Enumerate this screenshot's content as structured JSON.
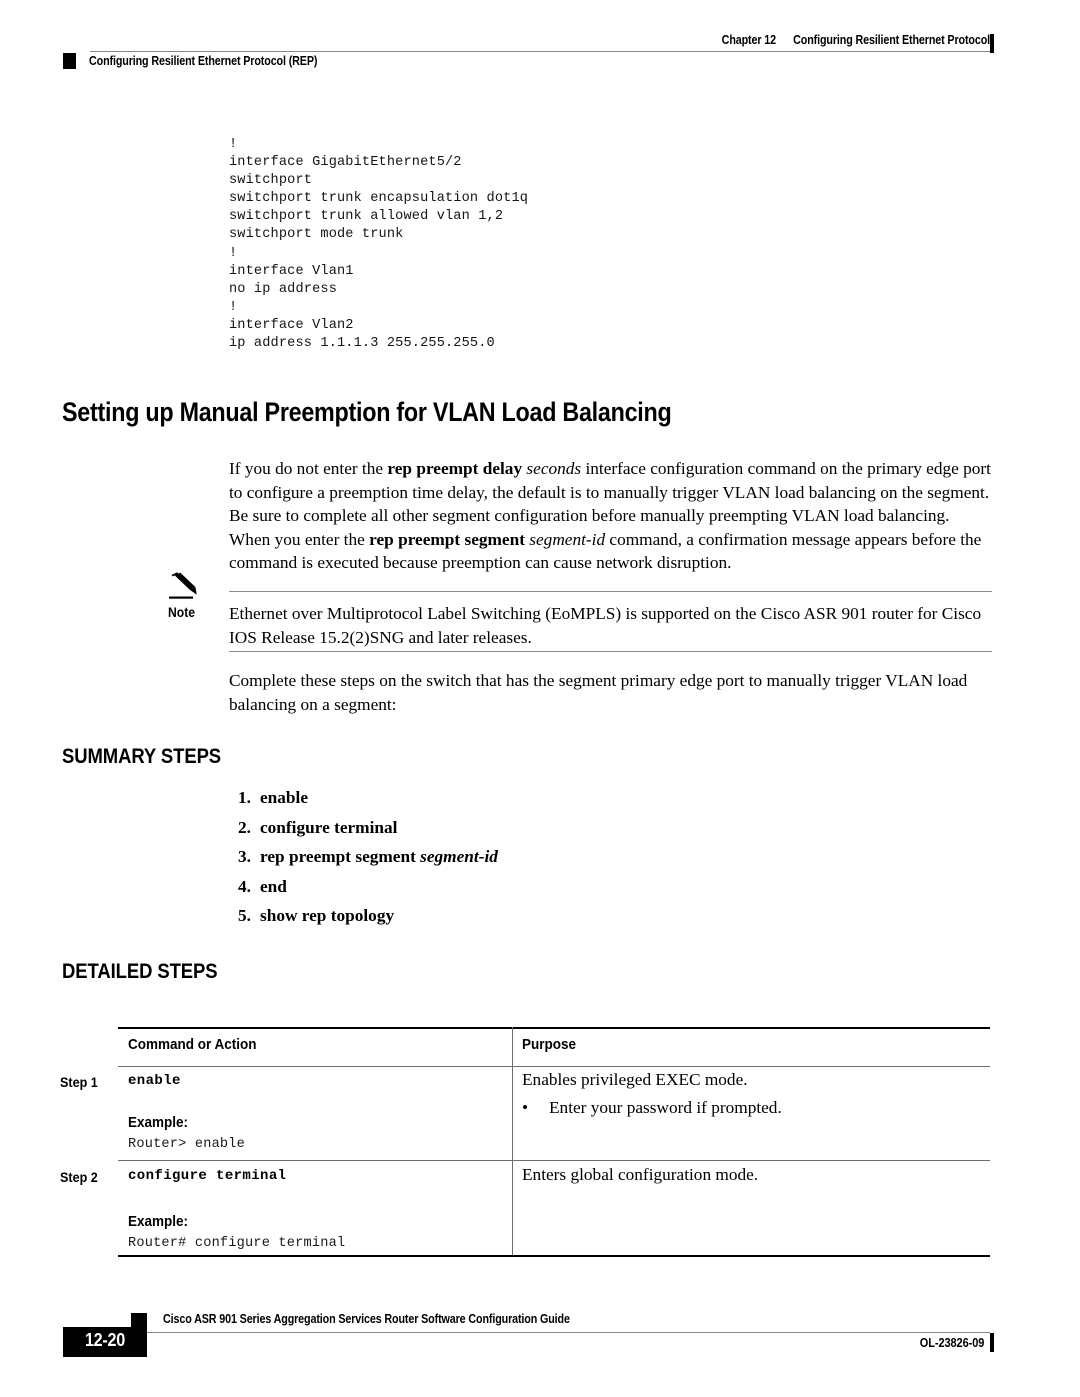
{
  "header": {
    "chapter_number": "Chapter 12",
    "chapter_title": "Configuring Resilient Ethernet Protocol",
    "section_title": "Configuring Resilient Ethernet Protocol (REP)"
  },
  "code_block": {
    "text": "!\ninterface GigabitEthernet5/2\nswitchport\nswitchport trunk encapsulation dot1q\nswitchport trunk allowed vlan 1,2\nswitchport mode trunk\n!\ninterface Vlan1\nno ip address\n!\ninterface Vlan2\nip address 1.1.1.3 255.255.255.0"
  },
  "heading": {
    "title": "Setting up Manual Preemption for VLAN Load Balancing"
  },
  "paragraphs": {
    "intro_1": "If you do not enter the ",
    "intro_cmd1": "rep preempt delay",
    "intro_var1": "seconds",
    "intro_2": " interface configuration command on the primary edge port to configure a preemption time delay, the default is to manually trigger VLAN load balancing on the segment. Be sure to complete all other segment configuration before manually preempting VLAN load balancing. When you enter the ",
    "intro_cmd2": "rep preempt segment",
    "intro_var2": "segment-id",
    "intro_3": " command, a confirmation message appears before the command is executed because preemption can cause network disruption.",
    "complete": "Complete these steps on the switch that has the segment primary edge port to manually trigger VLAN load balancing on a segment:"
  },
  "note": {
    "label": "Note",
    "icon": "pencil-icon",
    "body": "Ethernet over Multiprotocol Label Switching (EoMPLS) is supported on the Cisco ASR 901 router for Cisco IOS Release 15.2(2)SNG and later releases."
  },
  "summary_steps": {
    "heading": "SUMMARY STEPS",
    "items": [
      {
        "num": "1.",
        "text": "enable",
        "var": ""
      },
      {
        "num": "2.",
        "text": "configure terminal",
        "var": ""
      },
      {
        "num": "3.",
        "text": "rep preempt segment ",
        "var": "segment-id"
      },
      {
        "num": "4.",
        "text": "end",
        "var": ""
      },
      {
        "num": "5.",
        "text": "show rep topology",
        "var": ""
      }
    ]
  },
  "detailed_steps": {
    "heading": "DETAILED STEPS",
    "columns": {
      "command": "Command or Action",
      "purpose": "Purpose"
    },
    "example_label": "Example:",
    "rows": [
      {
        "step_label": "Step 1",
        "command": "enable",
        "example": "Router> enable",
        "purpose": "Enables privileged EXEC mode.",
        "bullet": "Enter your password if prompted.",
        "bullet_dot": "•"
      },
      {
        "step_label": "Step 2",
        "command": "configure terminal",
        "example": "Router# configure terminal",
        "purpose": "Enters global configuration mode.",
        "bullet": "",
        "bullet_dot": ""
      }
    ]
  },
  "footer": {
    "page_number": "12-20",
    "book_title": "Cisco ASR 901 Series Aggregation Services Router Software Configuration Guide",
    "doc_id": "OL-23826-09"
  },
  "colors": {
    "rule_gray": "#86868a",
    "table_rule": "#6e6e72",
    "ink": "#000000",
    "paper": "#ffffff"
  }
}
